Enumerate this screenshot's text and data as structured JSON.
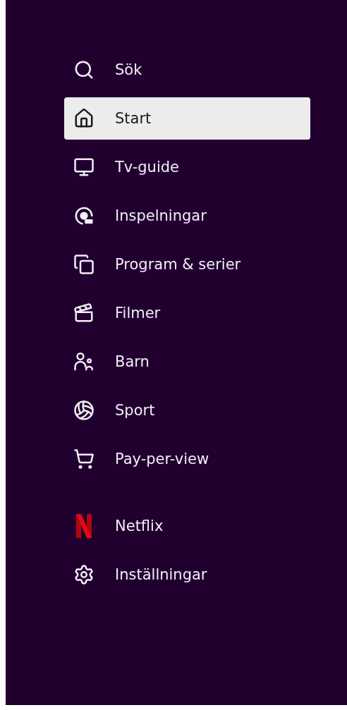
{
  "menu": [
    {
      "label": "Sök",
      "selected": false
    },
    {
      "label": "Start",
      "selected": true
    },
    {
      "label": "Tv-guide",
      "selected": false
    },
    {
      "label": "Inspelningar",
      "selected": false
    },
    {
      "label": "Program & serier",
      "selected": false
    },
    {
      "label": "Filmer",
      "selected": false
    },
    {
      "label": "Barn",
      "selected": false
    },
    {
      "label": "Sport",
      "selected": false
    },
    {
      "label": "Pay-per-view",
      "selected": false
    }
  ],
  "apps": [
    {
      "label": "Netflix",
      "selected": false
    },
    {
      "label": "Inställningar",
      "selected": false
    }
  ]
}
